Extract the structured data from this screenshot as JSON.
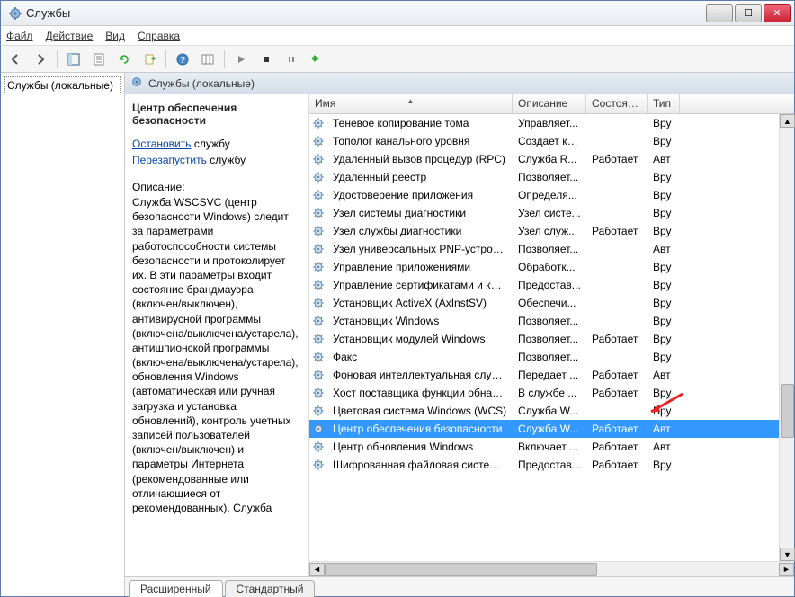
{
  "window": {
    "title": "Службы"
  },
  "menu": {
    "file": "Файл",
    "action": "Действие",
    "view": "Вид",
    "help": "Справка"
  },
  "tree": {
    "item": "Службы (локальные)"
  },
  "pane": {
    "header": "Службы (локальные)"
  },
  "detail": {
    "serviceName": "Центр обеспечения безопасности",
    "stopLabel": "Остановить",
    "stopSuffix": " службу",
    "restartLabel": "Перезапустить",
    "restartSuffix": " службу",
    "descLabel": "Описание:",
    "descText": "Служба WSCSVC (центр безопасности Windows) следит за параметрами работоспособности системы безопасности и протоколирует их. В эти параметры входит состояние брандмауэра (включен/выключен), антивирусной программы (включена/выключена/устарела), антишпионской программы (включена/выключена/устарела), обновления Windows (автоматическая или ручная загрузка и установка обновлений), контроль учетных записей пользователей (включен/выключен) и параметры Интернета (рекомендованные или отличающиеся от рекомендованных). Служба"
  },
  "columns": {
    "name": "Имя",
    "desc": "Описание",
    "state": "Состояние",
    "type": "Тип"
  },
  "rows": [
    {
      "name": "Теневое копирование тома",
      "desc": "Управляет...",
      "state": "",
      "type": "Вру"
    },
    {
      "name": "Тополог канального уровня",
      "desc": "Создает ка...",
      "state": "",
      "type": "Вру"
    },
    {
      "name": "Удаленный вызов процедур (RPC)",
      "desc": "Служба R...",
      "state": "Работает",
      "type": "Авт"
    },
    {
      "name": "Удаленный реестр",
      "desc": "Позволяет...",
      "state": "",
      "type": "Вру"
    },
    {
      "name": "Удостоверение приложения",
      "desc": "Определя...",
      "state": "",
      "type": "Вру"
    },
    {
      "name": "Узел системы диагностики",
      "desc": "Узел систе...",
      "state": "",
      "type": "Вру"
    },
    {
      "name": "Узел службы диагностики",
      "desc": "Узел служ...",
      "state": "Работает",
      "type": "Вру"
    },
    {
      "name": "Узел универсальных PNP-устройств",
      "desc": "Позволяет...",
      "state": "",
      "type": "Авт"
    },
    {
      "name": "Управление приложениями",
      "desc": "Обработк...",
      "state": "",
      "type": "Вру"
    },
    {
      "name": "Управление сертификатами и ключом ...",
      "desc": "Предостав...",
      "state": "",
      "type": "Вру"
    },
    {
      "name": "Установщик ActiveX (AxInstSV)",
      "desc": "Обеспечи...",
      "state": "",
      "type": "Вру"
    },
    {
      "name": "Установщик Windows",
      "desc": "Позволяет...",
      "state": "",
      "type": "Вру"
    },
    {
      "name": "Установщик модулей Windows",
      "desc": "Позволяет...",
      "state": "Работает",
      "type": "Вру"
    },
    {
      "name": "Факс",
      "desc": "Позволяет...",
      "state": "",
      "type": "Вру"
    },
    {
      "name": "Фоновая интеллектуальная служба пер...",
      "desc": "Передает ...",
      "state": "Работает",
      "type": "Авт"
    },
    {
      "name": "Хост поставщика функции обнаружения",
      "desc": "В службе ...",
      "state": "Работает",
      "type": "Вру"
    },
    {
      "name": "Цветовая система Windows (WCS)",
      "desc": "Служба W...",
      "state": "",
      "type": "Вру"
    },
    {
      "name": "Центр обеспечения безопасности",
      "desc": "Служба W...",
      "state": "Работает",
      "type": "Авт",
      "selected": true
    },
    {
      "name": "Центр обновления Windows",
      "desc": "Включает ...",
      "state": "Работает",
      "type": "Авт"
    },
    {
      "name": "Шифрованная файловая система (EFS)",
      "desc": "Предостав...",
      "state": "Работает",
      "type": "Вру"
    }
  ],
  "tabs": {
    "extended": "Расширенный",
    "standard": "Стандартный"
  }
}
